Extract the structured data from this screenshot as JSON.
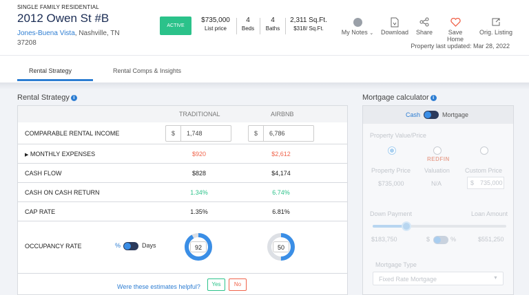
{
  "property": {
    "type": "SINGLE FAMILY RESIDENTIAL",
    "address": "2012 Owen St #B",
    "neighborhood": "Jones-Buena Vista",
    "city_state": ", Nashville, TN",
    "zip": "37208",
    "status": "ACTIVE",
    "price": "$735,000",
    "price_label": "List price",
    "beds": "4",
    "beds_label": "Beds",
    "baths": "4",
    "baths_label": "Baths",
    "sqft": "2,311 Sq.Ft.",
    "price_per_sqft": "$318/ Sq.Ft.",
    "last_updated": "Property last updated: Mar 28, 2022"
  },
  "actions": [
    {
      "label": "My Notes",
      "icon": "notes-avatar-icon"
    },
    {
      "label": "Download",
      "icon": "download-icon"
    },
    {
      "label": "Share",
      "icon": "share-icon"
    },
    {
      "label": "Save Home",
      "icon": "heart-icon"
    },
    {
      "label": "Orig. Listing",
      "icon": "external-link-icon"
    }
  ],
  "tabs": [
    {
      "label": "Rental Strategy",
      "active": true
    },
    {
      "label": "Rental Comps & Insights",
      "active": false
    }
  ],
  "rental_strategy": {
    "title": "Rental Strategy",
    "col_traditional": "TRADITIONAL",
    "col_airbnb": "AIRBNB",
    "rows": {
      "comparable_income": {
        "label": "COMPARABLE RENTAL INCOME",
        "currency": "$",
        "traditional": "1,748",
        "airbnb": "6,786"
      },
      "monthly_expenses": {
        "label": "MONTHLY EXPENSES",
        "traditional": "$920",
        "airbnb": "$2,612"
      },
      "cash_flow": {
        "label": "CASH FLOW",
        "traditional": "$828",
        "airbnb": "$4,174"
      },
      "coc_return": {
        "label": "CASH ON CASH RETURN",
        "traditional": "1.34%",
        "airbnb": "6.74%"
      },
      "cap_rate": {
        "label": "CAP RATE",
        "traditional": "1.35%",
        "airbnb": "6.81%"
      },
      "occupancy": {
        "label": "OCCUPANCY RATE",
        "toggle_left": "%",
        "toggle_right": "Days",
        "traditional": "92",
        "airbnb": "50",
        "traditional_fraction": 0.92,
        "airbnb_fraction": 0.5
      }
    },
    "feedback": {
      "question": "Were these estimates helpful?",
      "yes": "Yes",
      "no": "No"
    }
  },
  "mortgage": {
    "title": "Mortgage calculator",
    "toggle_left": "Cash",
    "toggle_right": "Mortgage",
    "property_value_label": "Property Value/Price",
    "redfin_logo": "REDFIN",
    "options": [
      {
        "label": "Property Price",
        "value": "$735,000"
      },
      {
        "label": "Valuation",
        "value": "N/A"
      },
      {
        "label": "Custom Price",
        "currency": "$",
        "value": "735,000"
      }
    ],
    "down_payment_label": "Down Payment",
    "loan_amount_label": "Loan Amount",
    "down_payment_value": "$183,750",
    "loan_amount_value": "$551,250",
    "toggle_dollar": "$",
    "toggle_percent": "%",
    "mortgage_type_label": "Mortgage Type",
    "mortgage_type_value": "Fixed Rate Mortgage"
  },
  "colors": {
    "accent": "#2d7dd2",
    "active_badge": "#2bc28a",
    "negative": "#f0634a",
    "positive": "#2bc28a",
    "ring": "#3a8ee6"
  }
}
